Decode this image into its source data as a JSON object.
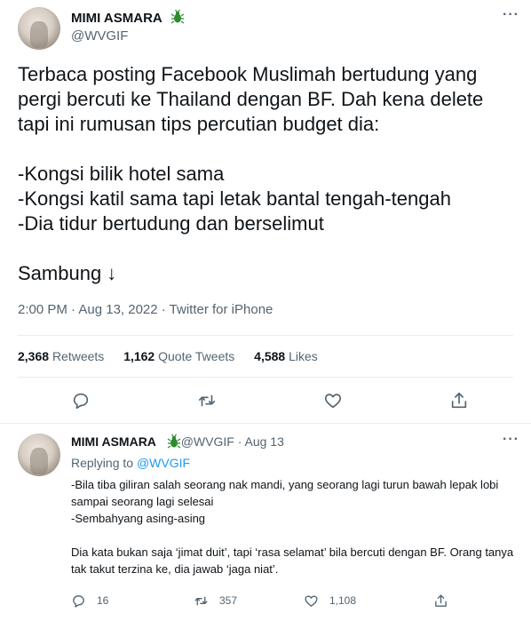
{
  "tweet": {
    "author": {
      "name": "MIMI ASMARA",
      "handle": "@WVGIF"
    },
    "text": "Terbaca posting Facebook Muslimah bertudung yang pergi bercuti ke Thailand dengan BF. Dah kena delete tapi ini rumusan tips percutian budget dia:\n\n-Kongsi bilik hotel sama\n-Kongsi katil sama tapi letak bantal tengah-tengah\n-Dia tidur bertudung dan berselimut\n\nSambung ↓",
    "meta": "2:00 PM · Aug 13, 2022 · Twitter for iPhone",
    "stats": {
      "retweets_count": "2,368",
      "retweets_label": "Retweets",
      "quotes_count": "1,162",
      "quotes_label": "Quote Tweets",
      "likes_count": "4,588",
      "likes_label": "Likes"
    }
  },
  "reply": {
    "author": {
      "name": "MIMI ASMARA",
      "handle": "@WVGIF",
      "date": "· Aug 13"
    },
    "replying_prefix": "Replying to ",
    "replying_handle": "@WVGIF",
    "text": "-Bila tiba giliran salah seorang nak mandi, yang seorang lagi turun bawah lepak lobi sampai seorang lagi selesai\n-Sembahyang asing-asing\n\nDia kata bukan saja ‘jimat duit’, tapi ‘rasa selamat’ bila bercuti dengan BF. Orang tanya tak takut terzina ke, dia jawab ‘jaga niat’.",
    "actions": {
      "replies": "16",
      "retweets": "357",
      "likes": "1,108"
    }
  },
  "more_label": "···",
  "colors": {
    "text": "#0f1419",
    "secondary": "#536471",
    "link": "#1d9bf0",
    "divider": "#e6ecf0",
    "badge": "#2e8b2e"
  }
}
